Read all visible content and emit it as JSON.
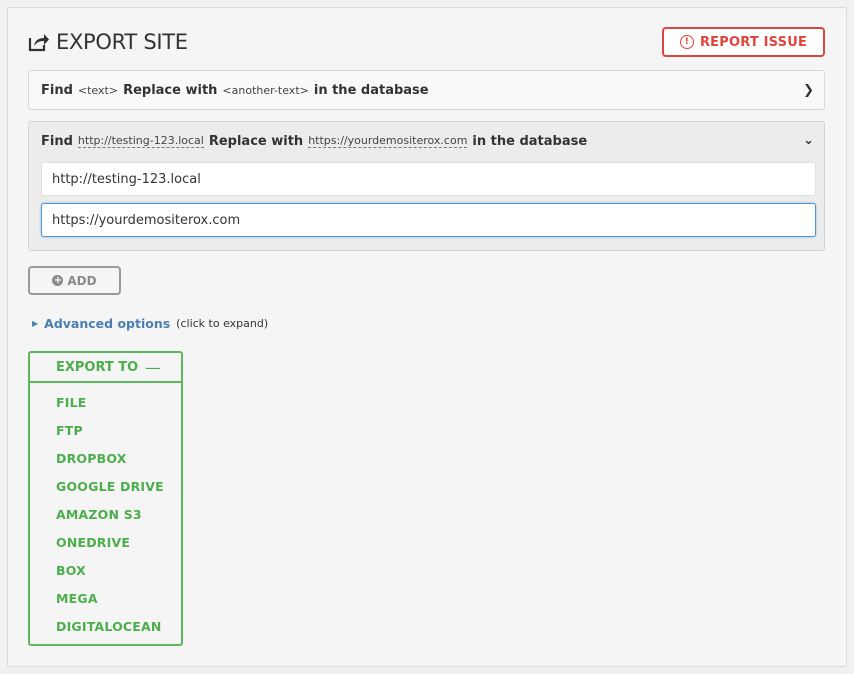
{
  "page": {
    "title": "EXPORT SITE",
    "report_label": "REPORT ISSUE"
  },
  "replace_rows": [
    {
      "find": "Find",
      "from": "<text>",
      "replace": "Replace with",
      "to": "<another-text>",
      "suffix": "in the database",
      "state": "collapsed"
    },
    {
      "find": "Find",
      "from": "http://testing-123.local",
      "replace": "Replace with",
      "to": "https://yourdemositerox.com",
      "suffix": "in the database",
      "state": "expanded",
      "find_value": "http://testing-123.local",
      "replace_value": "https://yourdemositerox.com"
    }
  ],
  "add_label": "ADD",
  "advanced": {
    "label": "Advanced options",
    "hint": "(click to expand)"
  },
  "export": {
    "header": "EXPORT TO",
    "items": [
      "FILE",
      "FTP",
      "DROPBOX",
      "GOOGLE DRIVE",
      "AMAZON S3",
      "ONEDRIVE",
      "BOX",
      "MEGA",
      "DIGITALOCEAN"
    ]
  },
  "colors": {
    "report": "#e0443a",
    "export_green": "#5cb85c",
    "link_blue": "#4a7fb0",
    "focus_blue": "#4f94d4"
  },
  "icons": {
    "title": "export-icon",
    "report": "alert-circle-icon",
    "row_collapsed": "chevron-right-icon",
    "row_expanded": "chevron-down-icon",
    "add": "plus-circle-icon",
    "advanced": "triangle-right-icon",
    "export_toggle": "minus-icon"
  }
}
